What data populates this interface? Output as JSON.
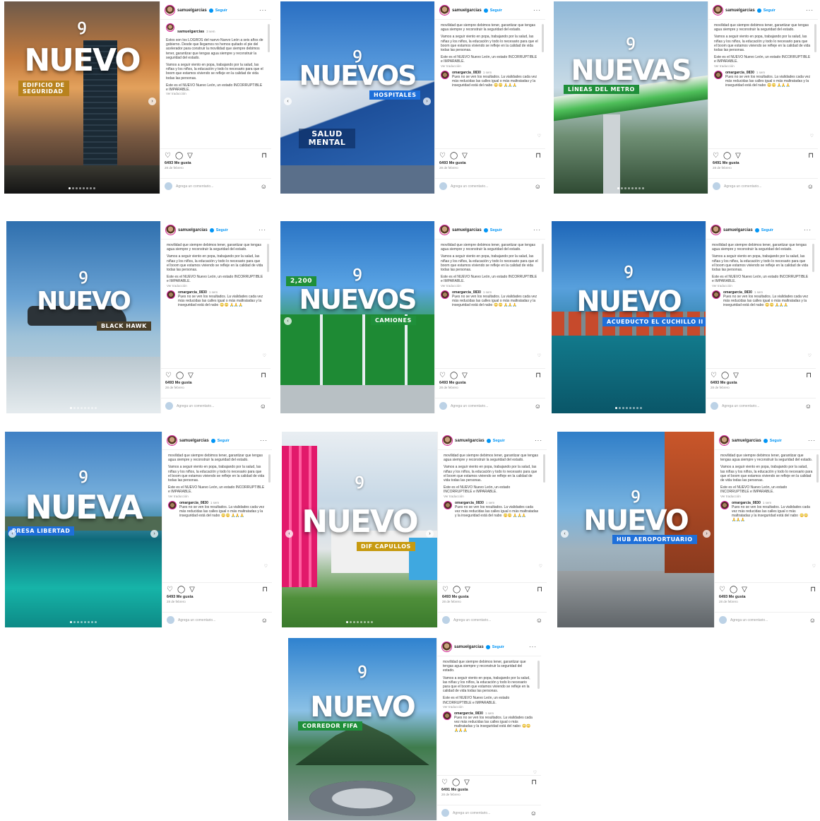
{
  "profile": {
    "username": "samuelgarcias",
    "follow_label": "Seguir",
    "more_label": "···"
  },
  "caption": {
    "time": "3 sem",
    "lead": "Estos son los LOGROS del nuevo Nuevo León a seis años de gobierno. Desde que llegamos no hemos quitado el pie del acelerador para construir la movilidad que siempre debimos tener, garantizar que tengas agua siempre y reconstruir la seguridad del estado.",
    "continued": "movilidad que siempre debimos tener, garantizar que tengas agua siempre y reconstruir la seguridad del estado.",
    "p2": "Vamos a seguir viento en popa, trabajando por la salud, las niñas y los niños, la educación y todo lo necesario para que el boom que estamos viviendo se refleje en la calidad de vida todas las personas.",
    "p3": "Este es el NUEVO Nuevo León, un estado INCORRUPTIBLE e IMPARABLE.",
    "translate": "Ver traducción"
  },
  "comment": {
    "user": "omargarcia_0830",
    "time": "1 sem",
    "text": "Pues no se ven los resultados. La vialidades cada vez más reducidas las calles igual o más maltratadas y la inseguridad está del nabo",
    "emoji": "😳😳 🙏🙏🙏"
  },
  "footer": {
    "likes": "6493 Me gusta",
    "likes_alt": "6491 Me gusta",
    "date": "28 de febrero",
    "add_comment": "Agrega un comentario...",
    "icons": [
      "heart-icon",
      "comment-icon",
      "share-icon",
      "bookmark-icon",
      "emoji-icon"
    ]
  },
  "posts": [
    {
      "id": "p1",
      "headline": "NUEVO",
      "tag": "EDIFICIO DE SEGURIDAD"
    },
    {
      "id": "p2",
      "headline": "NUEVOS",
      "tag": "HOSPITALES",
      "sign": "SALUD MENTAL"
    },
    {
      "id": "p3",
      "headline": "NUEVAS",
      "tag": "LÍNEAS DEL METRO"
    },
    {
      "id": "p4",
      "headline": "NUEVO",
      "tag": "BLACK HAWK"
    },
    {
      "id": "p5",
      "headline": "NUEVOS",
      "tag": "CAMIONES",
      "count": "2,200"
    },
    {
      "id": "p6",
      "headline": "NUEVO",
      "tag": "ACUEDUCTO EL CUCHILLO II"
    },
    {
      "id": "p7",
      "headline": "NUEVA",
      "tag": "PRESA LIBERTAD"
    },
    {
      "id": "p8",
      "headline": "NUEVO",
      "tag": "DIF CAPULLOS"
    },
    {
      "id": "p9",
      "headline": "NUEVO",
      "tag": "HUB AEROPORTUARIO"
    },
    {
      "id": "p10",
      "headline": "NUEVO",
      "tag": "CORREDOR FIFA"
    }
  ],
  "colors": {
    "link_blue": "#0095f6",
    "green_tag": "#1f8f3a",
    "blue_tag": "#1e6fd9",
    "orange_tag": "#b8821d"
  }
}
